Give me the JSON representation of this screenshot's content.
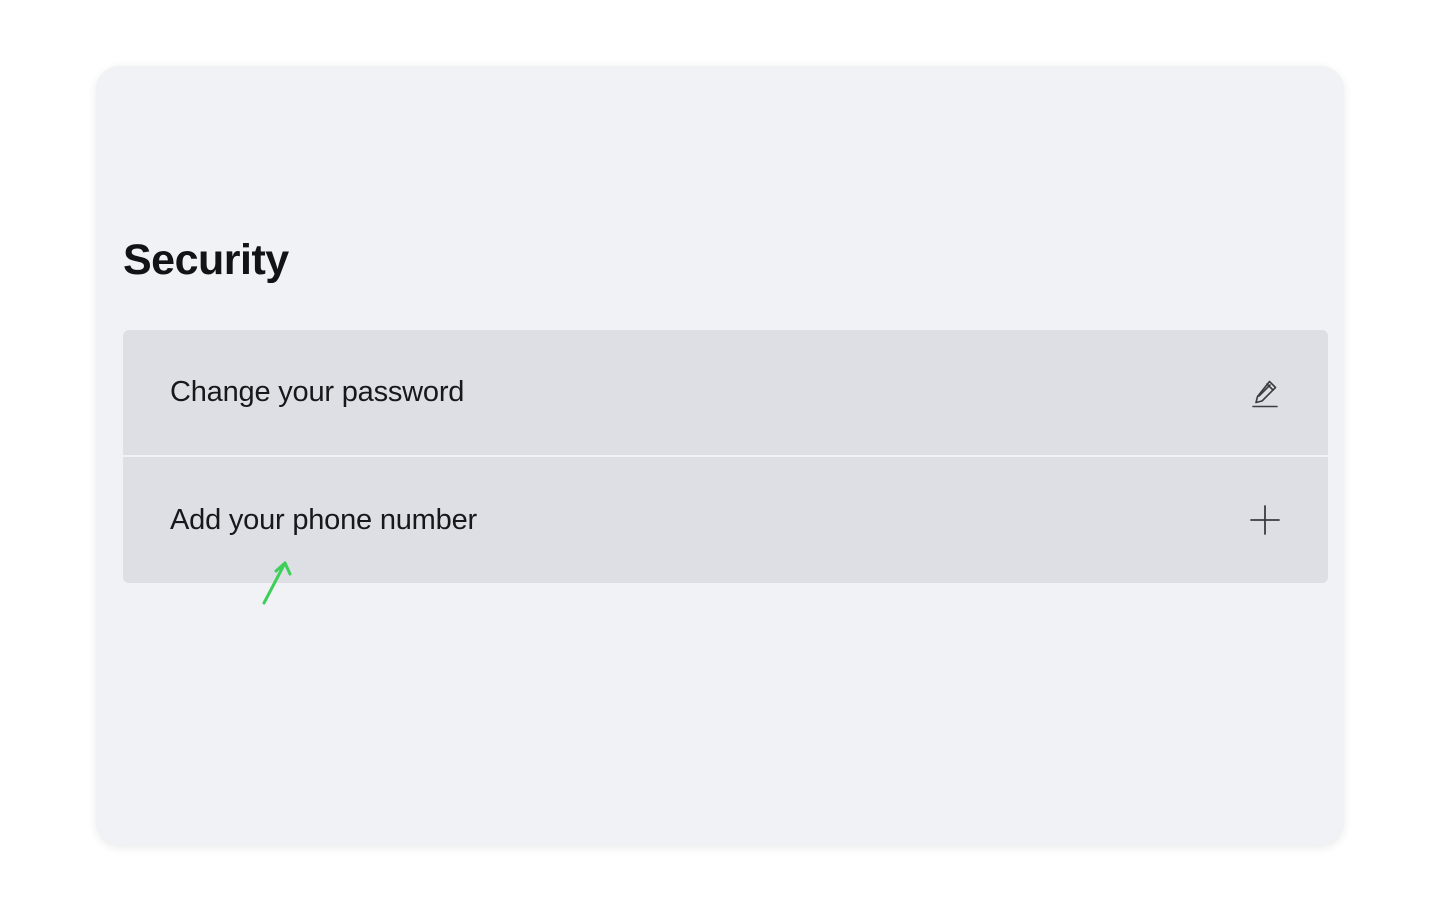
{
  "security": {
    "title": "Security",
    "items": [
      {
        "label": "Change your password",
        "icon": "pencil-icon"
      },
      {
        "label": "Add your phone number",
        "icon": "plus-icon"
      }
    ]
  },
  "annotation": {
    "icon": "arrow-up-right-icon",
    "color": "#3ecf5a"
  },
  "colors": {
    "card_bg": "#f1f2f6",
    "row_bg": "#dedfe4",
    "text": "#17181c"
  }
}
